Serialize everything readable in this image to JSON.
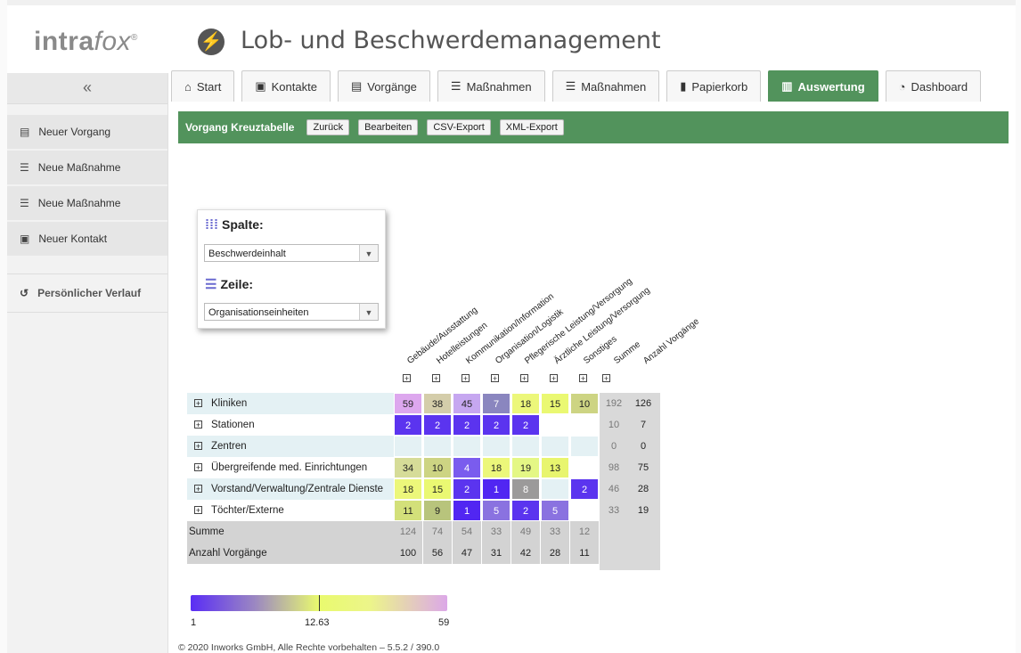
{
  "app": {
    "logo_main": "intra",
    "logo_italic": "fox",
    "logo_reg": "®",
    "title": "Lob- und Beschwerdemanagement"
  },
  "sidebar": {
    "collapse": "«",
    "items": [
      {
        "label": "Neuer Vorgang",
        "icon": "document-icon"
      },
      {
        "label": "Neue Maßnahme",
        "icon": "list-icon"
      },
      {
        "label": "Neue Maßnahme",
        "icon": "list-icon"
      },
      {
        "label": "Neuer Kontakt",
        "icon": "contact-card-icon"
      }
    ],
    "history": "Persönlicher Verlauf"
  },
  "tabs": [
    {
      "label": "Start",
      "icon": "home-icon"
    },
    {
      "label": "Kontakte",
      "icon": "contact-card-icon"
    },
    {
      "label": "Vorgänge",
      "icon": "document-icon"
    },
    {
      "label": "Maßnahmen",
      "icon": "list-icon"
    },
    {
      "label": "Maßnahmen",
      "icon": "list-icon"
    },
    {
      "label": "Papierkorb",
      "icon": "trash-icon"
    },
    {
      "label": "Auswertung",
      "icon": "bar-chart-icon",
      "active": true
    },
    {
      "label": "Dashboard",
      "icon": "pie-chart-icon"
    }
  ],
  "toolbar": {
    "title": "Vorgang Kreuztabelle",
    "back": "Zurück",
    "edit": "Bearbeiten",
    "csv": "CSV-Export",
    "xml": "XML-Export"
  },
  "pivot": {
    "column_label": "Spalte:",
    "column_value": "Beschwerdeinhalt",
    "row_label": "Zeile:",
    "row_value": "Organisationseinheiten"
  },
  "table": {
    "columns": [
      "Gebäude/Ausstattung",
      "Hotelleistungen",
      "Kommunikation/Information",
      "Organisation/Logistik",
      "Pflegerische Leistung/Versorgung",
      "Ärztliche Leistung/Versorgung",
      "Sonstiges"
    ],
    "sum_header": "Summe",
    "count_header": "Anzahl Vorgänge",
    "rows": [
      {
        "label": "Kliniken",
        "values": [
          "59",
          "38",
          "45",
          "7",
          "18",
          "15",
          "10"
        ],
        "sum": "192",
        "count": "126"
      },
      {
        "label": "Stationen",
        "values": [
          "2",
          "2",
          "2",
          "2",
          "2",
          "",
          ""
        ],
        "sum": "10",
        "count": "7"
      },
      {
        "label": "Zentren",
        "values": [
          "",
          "",
          "",
          "",
          "",
          "",
          ""
        ],
        "sum": "0",
        "count": "0"
      },
      {
        "label": "Übergreifende med. Einrichtungen",
        "values": [
          "34",
          "10",
          "4",
          "18",
          "19",
          "13",
          ""
        ],
        "sum": "98",
        "count": "75"
      },
      {
        "label": "Vorstand/Verwaltung/Zentrale Dienste",
        "values": [
          "18",
          "15",
          "2",
          "1",
          "8",
          "",
          "2"
        ],
        "sum": "46",
        "count": "28"
      },
      {
        "label": "Töchter/Externe",
        "values": [
          "11",
          "9",
          "1",
          "5",
          "2",
          "5",
          ""
        ],
        "sum": "33",
        "count": "19"
      }
    ],
    "sum_row": {
      "label": "Summe",
      "values": [
        "124",
        "74",
        "54",
        "33",
        "49",
        "33",
        "12"
      ]
    },
    "count_row": {
      "label": "Anzahl Vorgänge",
      "values": [
        "100",
        "56",
        "47",
        "31",
        "42",
        "28",
        "11"
      ]
    },
    "colors": {
      "59": "#dda7ee",
      "38": "#d4cdaa",
      "45": "#c6a7f0",
      "7": "#8a86bf",
      "18": "#ecf77a",
      "15": "#eaf872",
      "10": "#cdd483",
      "2": "#5b34ef",
      "34": "#d6dc98",
      "4": "#7a5cee",
      "19": "#e4f785",
      "13": "#e8f56e",
      "1": "#5126f2",
      "8": "#9b9a9a",
      "11": "#d3e07a",
      "9": "#b8c47c",
      "5": "#8a72e0"
    }
  },
  "legend": {
    "min": "1",
    "mid": "12.63",
    "max": "59"
  },
  "footer": "© 2020 Inworks GmbH, Alle Rechte vorbehalten – 5.5.2 / 390.0"
}
